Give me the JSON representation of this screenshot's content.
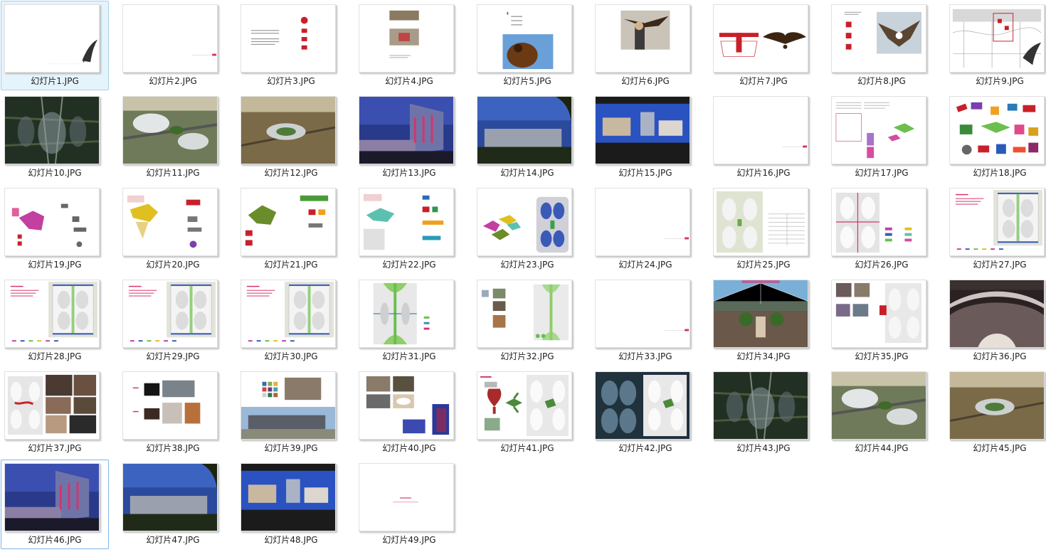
{
  "explorer": {
    "view": "large-icons",
    "files": [
      {
        "name": "幻灯片1.JPG",
        "style": "blank-logo"
      },
      {
        "name": "幻灯片2.JPG",
        "style": "blank-mark"
      },
      {
        "name": "幻灯片3.JPG",
        "style": "text-red"
      },
      {
        "name": "幻灯片4.JPG",
        "style": "photos-small"
      },
      {
        "name": "幻灯片5.JPG",
        "style": "eagle-sky"
      },
      {
        "name": "幻灯片6.JPG",
        "style": "falconer"
      },
      {
        "name": "幻灯片7.JPG",
        "style": "wings"
      },
      {
        "name": "幻灯片8.JPG",
        "style": "eagle-snow"
      },
      {
        "name": "幻灯片9.JPG",
        "style": "map-plan"
      },
      {
        "name": "幻灯片10.JPG",
        "style": "aerial-night"
      },
      {
        "name": "幻灯片11.JPG",
        "style": "aerial-day"
      },
      {
        "name": "幻灯片12.JPG",
        "style": "aerial-wide"
      },
      {
        "name": "幻灯片13.JPG",
        "style": "dusk-building"
      },
      {
        "name": "幻灯片14.JPG",
        "style": "dusk-low"
      },
      {
        "name": "幻灯片15.JPG",
        "style": "night-band"
      },
      {
        "name": "幻灯片16.JPG",
        "style": "blank-mark"
      },
      {
        "name": "幻灯片17.JPG",
        "style": "doc-diagram"
      },
      {
        "name": "幻灯片18.JPG",
        "style": "collage"
      },
      {
        "name": "幻灯片19.JPG",
        "style": "zone-pink"
      },
      {
        "name": "幻灯片20.JPG",
        "style": "zone-yellow"
      },
      {
        "name": "幻灯片21.JPG",
        "style": "zone-green"
      },
      {
        "name": "幻灯片22.JPG",
        "style": "zone-teal"
      },
      {
        "name": "幻灯片23.JPG",
        "style": "zone-plan"
      },
      {
        "name": "幻灯片24.JPG",
        "style": "blank-mark"
      },
      {
        "name": "幻灯片25.JPG",
        "style": "plan-table"
      },
      {
        "name": "幻灯片26.JPG",
        "style": "plan-legend"
      },
      {
        "name": "幻灯片27.JPG",
        "style": "plan-right"
      },
      {
        "name": "幻灯片28.JPG",
        "style": "plan-right"
      },
      {
        "name": "幻灯片29.JPG",
        "style": "plan-right"
      },
      {
        "name": "幻灯片30.JPG",
        "style": "plan-right"
      },
      {
        "name": "幻灯片31.JPG",
        "style": "plan-green"
      },
      {
        "name": "幻灯片32.JPG",
        "style": "plan-photos"
      },
      {
        "name": "幻灯片33.JPG",
        "style": "blank-mark"
      },
      {
        "name": "幻灯片34.JPG",
        "style": "atrium"
      },
      {
        "name": "幻灯片35.JPG",
        "style": "photos-plan"
      },
      {
        "name": "幻灯片36.JPG",
        "style": "roof-dark"
      },
      {
        "name": "幻灯片37.JPG",
        "style": "plan-interior"
      },
      {
        "name": "幻灯片38.JPG",
        "style": "materials"
      },
      {
        "name": "幻灯片39.JPG",
        "style": "facade-swatch"
      },
      {
        "name": "幻灯片40.JPG",
        "style": "photo-collage"
      },
      {
        "name": "幻灯片41.JPG",
        "style": "sculpture-plan"
      },
      {
        "name": "幻灯片42.JPG",
        "style": "night-plan"
      },
      {
        "name": "幻灯片43.JPG",
        "style": "aerial-night"
      },
      {
        "name": "幻灯片44.JPG",
        "style": "aerial-day"
      },
      {
        "name": "幻灯片45.JPG",
        "style": "aerial-wide"
      },
      {
        "name": "幻灯片46.JPG",
        "style": "dusk-building"
      },
      {
        "name": "幻灯片47.JPG",
        "style": "dusk-low"
      },
      {
        "name": "幻灯片48.JPG",
        "style": "night-band"
      },
      {
        "name": "幻灯片49.JPG",
        "style": "blank-center"
      }
    ],
    "selected_index": 0,
    "focus_index": 45,
    "colors": {
      "selected_bg": "#e5f3fb",
      "selected_border": "#a7d0ea",
      "accent_pink": "#d6336c",
      "accent_red": "#c8202a"
    }
  }
}
